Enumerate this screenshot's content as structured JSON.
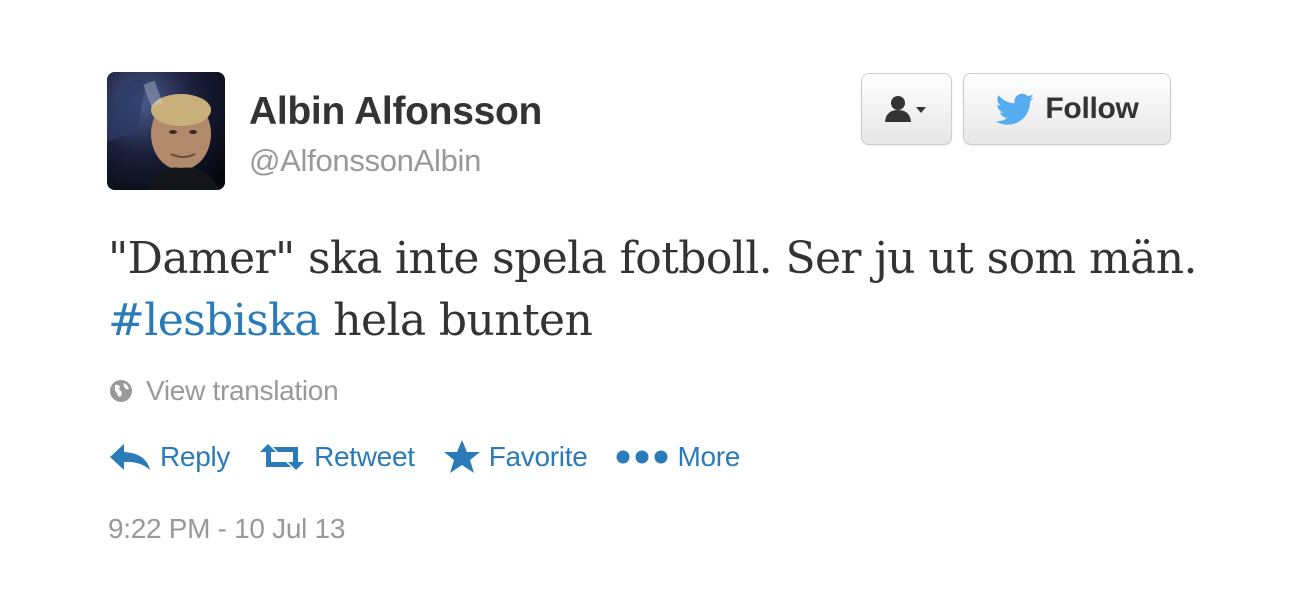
{
  "user": {
    "display_name": "Albin Alfonsson",
    "handle": "@AlfonssonAlbin"
  },
  "buttons": {
    "follow_label": "Follow"
  },
  "tweet": {
    "text_before": "\"Damer\" ska inte spela fotboll. Ser ju ut som män. ",
    "hashtag": "#lesbiska",
    "text_after": " hela bunten"
  },
  "translation": {
    "label": "View translation"
  },
  "actions": {
    "reply": "Reply",
    "retweet": "Retweet",
    "favorite": "Favorite",
    "more": "More"
  },
  "timestamp": "9:22 PM - 10 Jul 13",
  "colors": {
    "link": "#2b7bb9",
    "text": "#333333",
    "muted": "#999999"
  },
  "icons": [
    "user-dropdown-icon",
    "twitter-bird-icon",
    "globe-icon",
    "reply-icon",
    "retweet-icon",
    "favorite-star-icon",
    "more-dots-icon"
  ]
}
